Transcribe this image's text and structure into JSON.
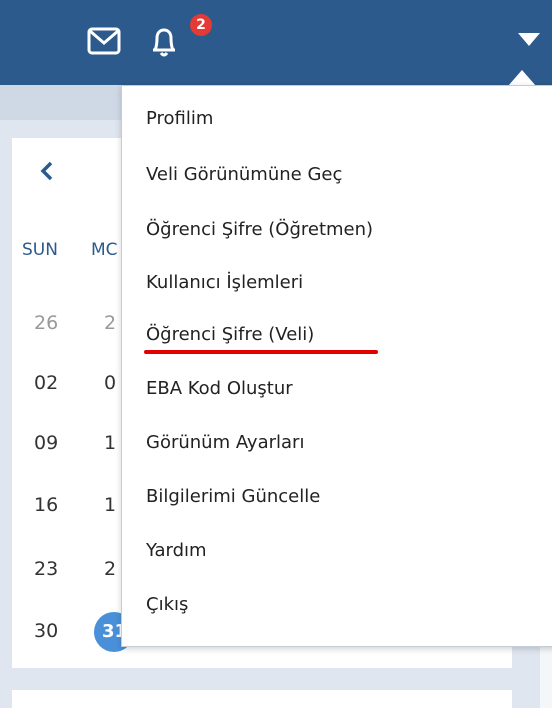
{
  "header": {
    "notification_count": "2",
    "icons": [
      "mail-icon",
      "bell-icon",
      "caret-down-icon"
    ]
  },
  "calendar": {
    "prev_icon": "chevron-left-icon",
    "dow": [
      "SUN",
      "MC"
    ],
    "col_sun": [
      "26",
      "02",
      "09",
      "16",
      "23",
      "30"
    ],
    "col_mon": [
      "2",
      "0",
      "1",
      "1",
      "2"
    ],
    "today": "31"
  },
  "menu": {
    "items": [
      "Profilim",
      "Veli Görünümüne Geç",
      "Öğrenci Şifre (Öğretmen)",
      "Kullanıcı İşlemleri",
      "Öğrenci Şifre (Veli)",
      "EBA Kod Oluştur",
      "Görünüm Ayarları",
      "Bilgilerimi Güncelle",
      "Yardım",
      "Çıkış"
    ],
    "highlight_color": "#e00000"
  },
  "colors": {
    "header_bg": "#2c5a8c",
    "accent": "#4a90d9",
    "badge": "#e53935"
  }
}
